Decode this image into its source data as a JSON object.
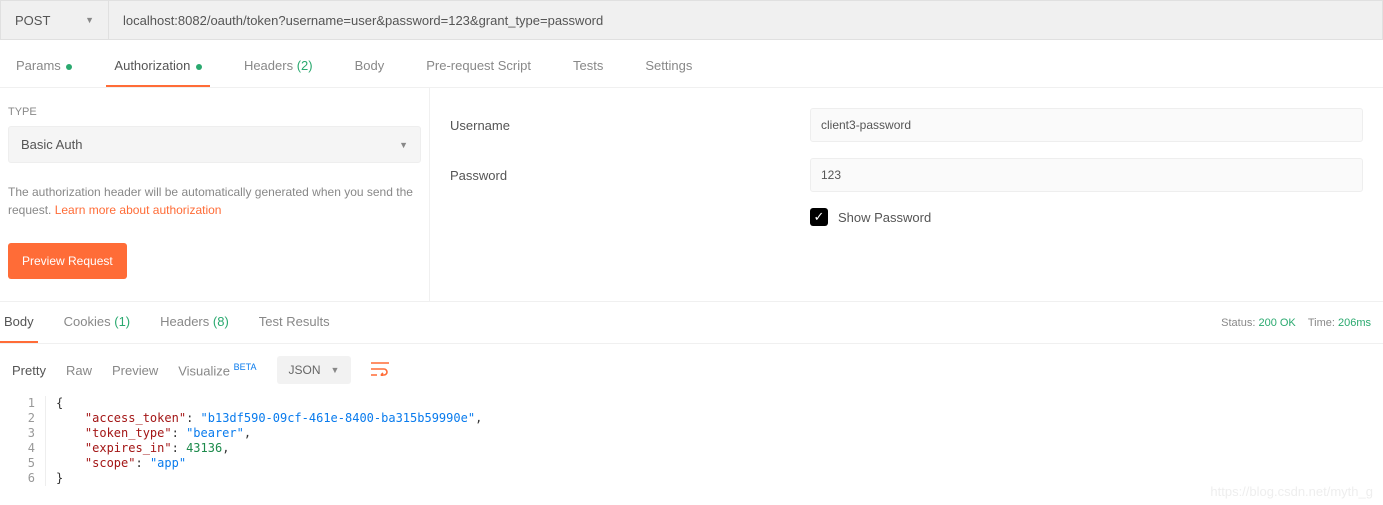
{
  "request": {
    "method": "POST",
    "url": "localhost:8082/oauth/token?username=user&password=123&grant_type=password"
  },
  "tabs": {
    "params": "Params",
    "authorization": "Authorization",
    "headers": "Headers",
    "headers_count": "(2)",
    "body": "Body",
    "prescript": "Pre-request Script",
    "tests": "Tests",
    "settings": "Settings"
  },
  "auth": {
    "type_label": "TYPE",
    "type_value": "Basic Auth",
    "hint_text": "The authorization header will be automatically generated when you send the request. ",
    "learn_more": "Learn more about authorization",
    "preview_btn": "Preview Request",
    "username_label": "Username",
    "username_value": "client3-password",
    "password_label": "Password",
    "password_value": "123",
    "show_password": "Show Password"
  },
  "response": {
    "tabs": {
      "body": "Body",
      "cookies": "Cookies",
      "cookies_count": "(1)",
      "headers": "Headers",
      "headers_count": "(8)",
      "test_results": "Test Results"
    },
    "status_label": "Status:",
    "status_value": "200 OK",
    "time_label": "Time:",
    "time_value": "206ms",
    "view": {
      "pretty": "Pretty",
      "raw": "Raw",
      "preview": "Preview",
      "visualize": "Visualize",
      "beta": "BETA",
      "format": "JSON"
    },
    "code": {
      "l1": "{",
      "l2a": "\"access_token\"",
      "l2b": ": ",
      "l2c": "\"b13df590-09cf-461e-8400-ba315b59990e\"",
      "l2d": ",",
      "l3a": "\"token_type\"",
      "l3b": ": ",
      "l3c": "\"bearer\"",
      "l3d": ",",
      "l4a": "\"expires_in\"",
      "l4b": ": ",
      "l4c": "43136",
      "l4d": ",",
      "l5a": "\"scope\"",
      "l5b": ": ",
      "l5c": "\"app\"",
      "l6": "}"
    },
    "lines": [
      "1",
      "2",
      "3",
      "4",
      "5",
      "6"
    ]
  },
  "watermark": "https://blog.csdn.net/myth_g"
}
